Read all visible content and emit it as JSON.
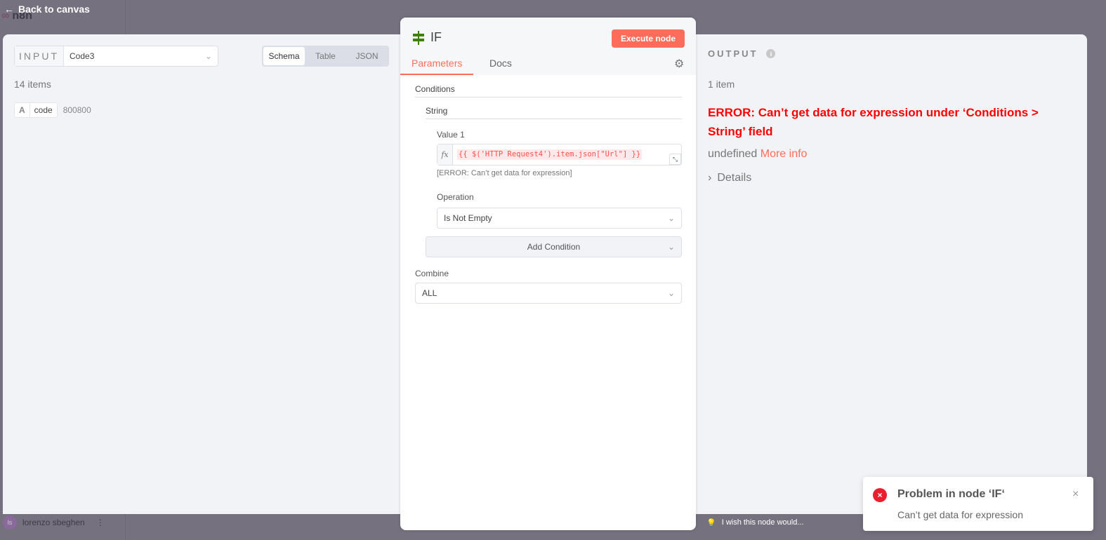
{
  "topbar": {
    "back_label": "Back to canvas",
    "logo": "n8n"
  },
  "input": {
    "label": "INPUT",
    "node": "Code3",
    "view_tabs": [
      "Schema",
      "Table",
      "JSON"
    ],
    "active_view": "Schema",
    "count": "14 items",
    "fields": [
      {
        "type": "A",
        "name": "code",
        "value": "800800"
      }
    ]
  },
  "node": {
    "title": "IF",
    "execute_label": "Execute node",
    "tabs": [
      "Parameters",
      "Docs"
    ],
    "conditions_label": "Conditions",
    "string_label": "String",
    "value1_label": "Value 1",
    "value1_expr": "{{ $('HTTP Request4').item.json[\"Url\"] }}",
    "value1_hint": "[ERROR: Can’t get data for expression]",
    "operation_label": "Operation",
    "operation_value": "Is Not Empty",
    "add_condition_label": "Add Condition",
    "combine_label": "Combine",
    "combine_value": "ALL"
  },
  "output": {
    "label": "OUTPUT",
    "count": "1 item",
    "error_title": "ERROR: Can’t get data for expression under ‘Conditions > String’ field",
    "undefined_text": "undefined",
    "more_info": "More info",
    "details": "Details"
  },
  "footer": {
    "user_initials": "ls",
    "user_name": "lorenzo sbeghen",
    "wish": "I wish this node would..."
  },
  "toast": {
    "title": "Problem in node ‘IF‘",
    "message": "Can’t get data for expression"
  },
  "colors": {
    "accent": "#ff6d5a",
    "error": "#ff0000"
  }
}
